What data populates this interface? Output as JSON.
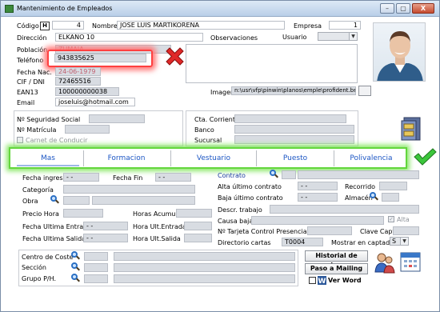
{
  "window": {
    "title": "Mantenimiento de Empleados",
    "min": "–",
    "max": "▢",
    "close": "X"
  },
  "header": {
    "codigo_label": "Código",
    "codigo_btn": "H",
    "codigo_value": "4",
    "nombre_label": "Nombre",
    "nombre_value": "JOSE LUIS MARTIKORENA",
    "empresa_label": "Empresa",
    "empresa_value": "1",
    "direccion_label": "Dirección",
    "direccion_value": "ELKANO 10",
    "observaciones_label": "Observaciones",
    "usuario_label": "Usuario",
    "usuario_value": "",
    "poblacion_label": "Población",
    "poblacion_value": "ZUMAIA",
    "telefono_label": "Teléfono",
    "telefono_value": "943835625",
    "fecha_nac_label": "Fecha Nac.",
    "fecha_nac_value": "24-06-1979",
    "cif_label": "CIF / DNI",
    "cif_value": "72465516",
    "ean_label": "EAN13",
    "ean_value": "100000000038",
    "imagen_label": "Imagen",
    "imagen_value": "n:\\usr\\vfp\\pinwin\\planos\\emple\\profident.bmp",
    "email_label": "Email",
    "email_value": "joseluis@hotmail.com"
  },
  "social": {
    "ss_label": "Nº Seguridad Social",
    "matricula_label": "Nº Matrícula",
    "carnet_label": "Carnet de Conducir",
    "cuenta_label": "Cta. Corriente",
    "banco_label": "Banco",
    "sucursal_label": "Sucursal"
  },
  "tabs": [
    "Mas",
    "Formacion",
    "Vestuario",
    "Puesto",
    "Polivalencia"
  ],
  "mas": {
    "fecha_ingreso_label": "Fecha ingreso",
    "fecha_ingreso_value": "- -",
    "fecha_fin_label": "Fecha Fin",
    "fecha_fin_value": "- -",
    "categoria_label": "Categoría",
    "obra_label": "Obra",
    "precio_hora_label": "Precio Hora",
    "horas_acumul_label": "Horas Acumul.",
    "fue_label": "Fecha Ultima Entrada",
    "fue_value": "- -",
    "hue_label": "Hora Ult.Entrada",
    "fus_label": "Fecha Ultima Salida",
    "fus_value": "- -",
    "hus_label": "Hora Ult.Salida",
    "contrato_label": "Contrato",
    "alta_ult_label": "Alta último contrato",
    "alta_ult_value": "- -",
    "recorrido_label": "Recorrido",
    "baja_ult_label": "Baja último contrato",
    "baja_ult_value": "- -",
    "almacen_label": "Almacén",
    "descr_label": "Descr. trabajo",
    "causa_label": "Causa baja",
    "alta_chk_label": "Alta",
    "tarjeta_label": "Nº Tarjeta Control Presencia",
    "clave_label": "Clave Capt.",
    "dir_cartas_label": "Directorio cartas",
    "dir_cartas_value": "T0004",
    "mostrar_label": "Mostrar en captador",
    "mostrar_value": "S"
  },
  "bottom": {
    "centro_label": "Centro de Coste",
    "seccion_label": "Sección",
    "grupo_label": "Grupo P/H.",
    "historial_btn": "Historial de obras",
    "mailing_btn": "Paso a Mailing",
    "ver_word_label": "Ver Word"
  },
  "colors": {
    "highlight_red": "#ff2a2a",
    "highlight_green": "#63d63c",
    "tab_text": "#1c56c4",
    "field_bg": "#d8dce2"
  },
  "icons": [
    "app-icon",
    "red-x-icon",
    "green-check-icon",
    "cabinet-icon",
    "magnifier-icon",
    "people-icon",
    "calendar-icon",
    "word-icon",
    "employee-photo"
  ]
}
